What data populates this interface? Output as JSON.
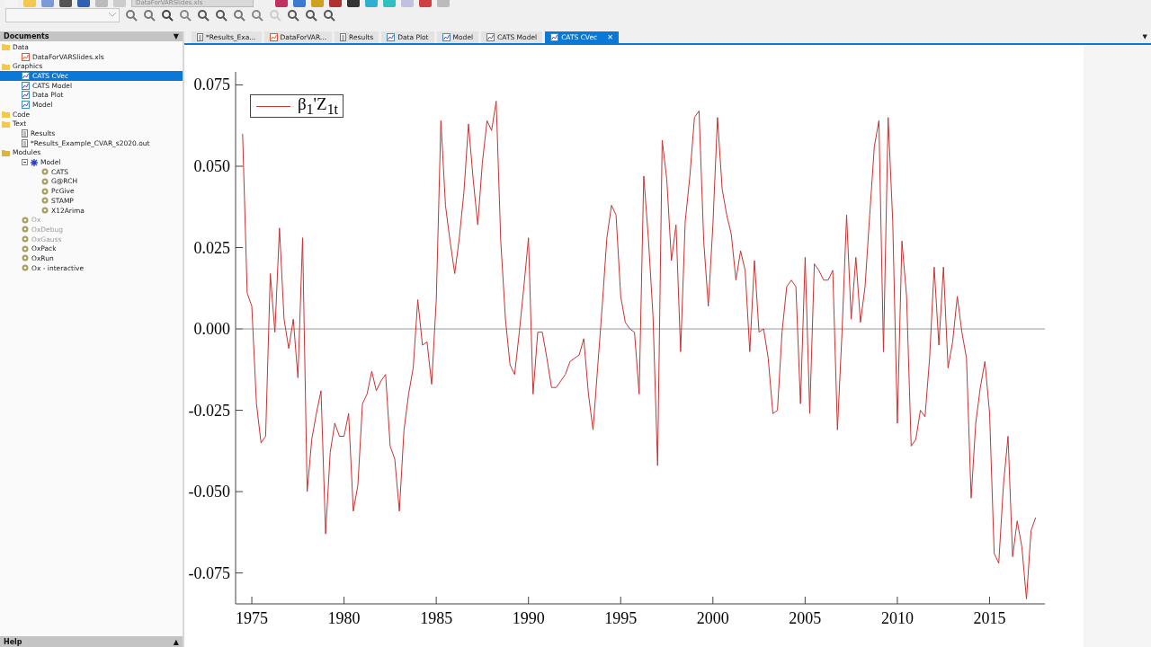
{
  "toolbar": {
    "file_combo": "DataForVARSlides.xls"
  },
  "sidebar": {
    "title": "Documents",
    "toggle": "▼",
    "tree": [
      {
        "label": "Data",
        "kind": "folder",
        "selected": false,
        "children": [
          {
            "label": "DataForVARSlides.xls",
            "kind": "sheet",
            "selected": false
          }
        ]
      },
      {
        "label": "Graphics",
        "kind": "folder",
        "selected": false,
        "children": [
          {
            "label": "CATS CVec",
            "kind": "graph",
            "selected": true
          },
          {
            "label": "CATS Model",
            "kind": "graph",
            "selected": false
          },
          {
            "label": "Data Plot",
            "kind": "graph",
            "selected": false
          },
          {
            "label": "Model",
            "kind": "graph",
            "selected": false
          }
        ]
      },
      {
        "label": "Code",
        "kind": "folder",
        "selected": false
      },
      {
        "label": "Text",
        "kind": "folder",
        "selected": false,
        "children": [
          {
            "label": "Results",
            "kind": "text",
            "selected": false
          },
          {
            "label": "*Results_Example_CVAR_s2020.out",
            "kind": "text",
            "selected": false
          }
        ]
      },
      {
        "label": "Modules",
        "kind": "modules",
        "selected": false,
        "children": [
          {
            "label": "Model",
            "kind": "model",
            "selected": false,
            "expanded": true,
            "children": [
              {
                "label": "CATS",
                "kind": "gear",
                "selected": false,
                "disabled": false
              },
              {
                "label": "G@RCH",
                "kind": "gear",
                "selected": false,
                "disabled": false
              },
              {
                "label": "PcGive",
                "kind": "gear",
                "selected": false,
                "disabled": false
              },
              {
                "label": "STAMP",
                "kind": "gear",
                "selected": false,
                "disabled": false
              },
              {
                "label": "X12Arima",
                "kind": "gear",
                "selected": false,
                "disabled": false
              }
            ]
          },
          {
            "label": "Ox",
            "kind": "gear",
            "selected": false,
            "disabled": true
          },
          {
            "label": "OxDebug",
            "kind": "gear",
            "selected": false,
            "disabled": true
          },
          {
            "label": "OxGauss",
            "kind": "gear",
            "selected": false,
            "disabled": true
          },
          {
            "label": "OxPack",
            "kind": "gear",
            "selected": false,
            "disabled": false
          },
          {
            "label": "OxRun",
            "kind": "gear",
            "selected": false,
            "disabled": false
          },
          {
            "label": "Ox - interactive",
            "kind": "gear",
            "selected": false,
            "disabled": false
          }
        ]
      }
    ]
  },
  "help_bar": {
    "title": "Help",
    "toggle": "▲"
  },
  "tabs": [
    {
      "label": "*Results_Exa...",
      "kind": "text",
      "selected": false
    },
    {
      "label": "DataForVAR...",
      "kind": "sheet",
      "selected": false
    },
    {
      "label": "Results",
      "kind": "text",
      "selected": false
    },
    {
      "label": "Data Plot",
      "kind": "graph",
      "selected": false
    },
    {
      "label": "Model",
      "kind": "graph",
      "selected": false
    },
    {
      "label": "CATS Model",
      "kind": "graph",
      "selected": false
    },
    {
      "label": "CATS CVec",
      "kind": "graph",
      "selected": true,
      "close": "✕"
    }
  ],
  "tab_menu": "▼",
  "graph": {
    "chart_data": {
      "type": "line",
      "series": [
        {
          "name": "β$_{1}$'Z$_{1t}$",
          "color": "#c83232",
          "values": [
            0.06,
            0.011,
            0.007,
            -0.023,
            -0.035,
            -0.033,
            0.017,
            -0.001,
            0.031,
            0.003,
            -0.006,
            0.003,
            -0.015,
            0.028,
            -0.05,
            -0.034,
            -0.026,
            -0.019,
            -0.063,
            -0.038,
            -0.029,
            -0.033,
            -0.033,
            -0.026,
            -0.056,
            -0.048,
            -0.023,
            -0.02,
            -0.013,
            -0.019,
            -0.016,
            -0.014,
            -0.036,
            -0.04,
            -0.056,
            -0.031,
            -0.02,
            -0.012,
            0.009,
            -0.005,
            -0.004,
            -0.017,
            0.009,
            0.064,
            0.038,
            0.027,
            0.017,
            0.028,
            0.042,
            0.063,
            0.046,
            0.032,
            0.051,
            0.064,
            0.061,
            0.07,
            0.027,
            0.003,
            -0.011,
            -0.014,
            -0.001,
            0.013,
            0.028,
            -0.02,
            -0.001,
            -0.001,
            -0.009,
            -0.018,
            -0.018,
            -0.016,
            -0.014,
            -0.01,
            -0.009,
            -0.008,
            -0.003,
            -0.02,
            -0.031,
            -0.012,
            0.007,
            0.028,
            0.038,
            0.035,
            0.01,
            0.002,
            0.0,
            -0.001,
            -0.02,
            0.047,
            0.028,
            0.004,
            -0.042,
            0.058,
            0.046,
            0.021,
            0.032,
            -0.007,
            0.033,
            0.047,
            0.065,
            0.067,
            0.027,
            0.007,
            0.032,
            0.065,
            0.043,
            0.035,
            0.029,
            0.015,
            0.024,
            0.018,
            -0.007,
            0.021,
            -0.001,
            0.0,
            -0.009,
            -0.026,
            -0.025,
            -0.001,
            0.013,
            0.015,
            0.013,
            -0.023,
            0.022,
            -0.026,
            0.02,
            0.018,
            0.015,
            0.015,
            0.018,
            -0.031,
            -0.001,
            0.035,
            0.003,
            0.022,
            0.002,
            0.013,
            0.035,
            0.056,
            0.064,
            -0.007,
            0.065,
            0.033,
            -0.029,
            0.027,
            0.01,
            -0.036,
            -0.034,
            -0.025,
            -0.027,
            -0.009,
            0.019,
            -0.005,
            0.019,
            -0.012,
            -0.004,
            0.01,
            -0.001,
            -0.009,
            -0.052,
            -0.029,
            -0.018,
            -0.01,
            -0.026,
            -0.069,
            -0.072,
            -0.048,
            -0.033,
            -0.07,
            -0.059,
            -0.067,
            -0.083,
            -0.062,
            -0.058
          ]
        }
      ],
      "x": [
        1974.5,
        1974.75,
        1975,
        1975.25,
        1975.5,
        1975.75,
        1976,
        1976.25,
        1976.5,
        1976.75,
        1977,
        1977.25,
        1977.5,
        1977.75,
        1978,
        1978.25,
        1978.5,
        1978.75,
        1979,
        1979.25,
        1979.5,
        1979.75,
        1980,
        1980.25,
        1980.5,
        1980.75,
        1981,
        1981.25,
        1981.5,
        1981.75,
        1982,
        1982.25,
        1982.5,
        1982.75,
        1983,
        1983.25,
        1983.5,
        1983.75,
        1984,
        1984.25,
        1984.5,
        1984.75,
        1985,
        1985.25,
        1985.5,
        1985.75,
        1986,
        1986.25,
        1986.5,
        1986.75,
        1987,
        1987.25,
        1987.5,
        1987.75,
        1988,
        1988.25,
        1988.5,
        1988.75,
        1989,
        1989.25,
        1989.5,
        1989.75,
        1990,
        1990.25,
        1990.5,
        1990.75,
        1991,
        1991.25,
        1991.5,
        1991.75,
        1992,
        1992.25,
        1992.5,
        1992.75,
        1993,
        1993.25,
        1993.5,
        1993.75,
        1994,
        1994.25,
        1994.5,
        1994.75,
        1995,
        1995.25,
        1995.5,
        1995.75,
        1996,
        1996.25,
        1996.5,
        1996.75,
        1997,
        1997.25,
        1997.5,
        1997.75,
        1998,
        1998.25,
        1998.5,
        1998.75,
        1999,
        1999.25,
        1999.5,
        1999.75,
        2000,
        2000.25,
        2000.5,
        2000.75,
        2001,
        2001.25,
        2001.5,
        2001.75,
        2002,
        2002.25,
        2002.5,
        2002.75,
        2003,
        2003.25,
        2003.5,
        2003.75,
        2004,
        2004.25,
        2004.5,
        2004.75,
        2005,
        2005.25,
        2005.5,
        2005.75,
        2006,
        2006.25,
        2006.5,
        2006.75,
        2007,
        2007.25,
        2007.5,
        2007.75,
        2008,
        2008.25,
        2008.5,
        2008.75,
        2009,
        2009.25,
        2009.5,
        2009.75,
        2010,
        2010.25,
        2010.5,
        2010.75,
        2011,
        2011.25,
        2011.5,
        2011.75,
        2012,
        2012.25,
        2012.5,
        2012.75,
        2013,
        2013.25,
        2013.5,
        2013.75,
        2014,
        2014.25,
        2014.5,
        2014.75,
        2015,
        2015.25,
        2015.5,
        2015.75,
        2016,
        2016.25,
        2016.5,
        2016.75,
        2017,
        2017.25,
        2017.5
      ],
      "xlim": [
        1974.12,
        2018.0
      ],
      "ylim": [
        -0.0845,
        0.079
      ],
      "xticks": [
        1975,
        1980,
        1985,
        1990,
        1995,
        2000,
        2005,
        2010,
        2015
      ],
      "yticks": [
        {
          "value": 0.075,
          "label": "0.075"
        },
        {
          "value": 0.05,
          "label": "0.050"
        },
        {
          "value": 0.025,
          "label": "0.025"
        },
        {
          "value": 0,
          "label": "0.000"
        },
        {
          "value": -0.025,
          "label": "-0.025"
        },
        {
          "value": -0.05,
          "label": "-0.050"
        },
        {
          "value": -0.075,
          "label": "-0.075"
        }
      ]
    }
  }
}
